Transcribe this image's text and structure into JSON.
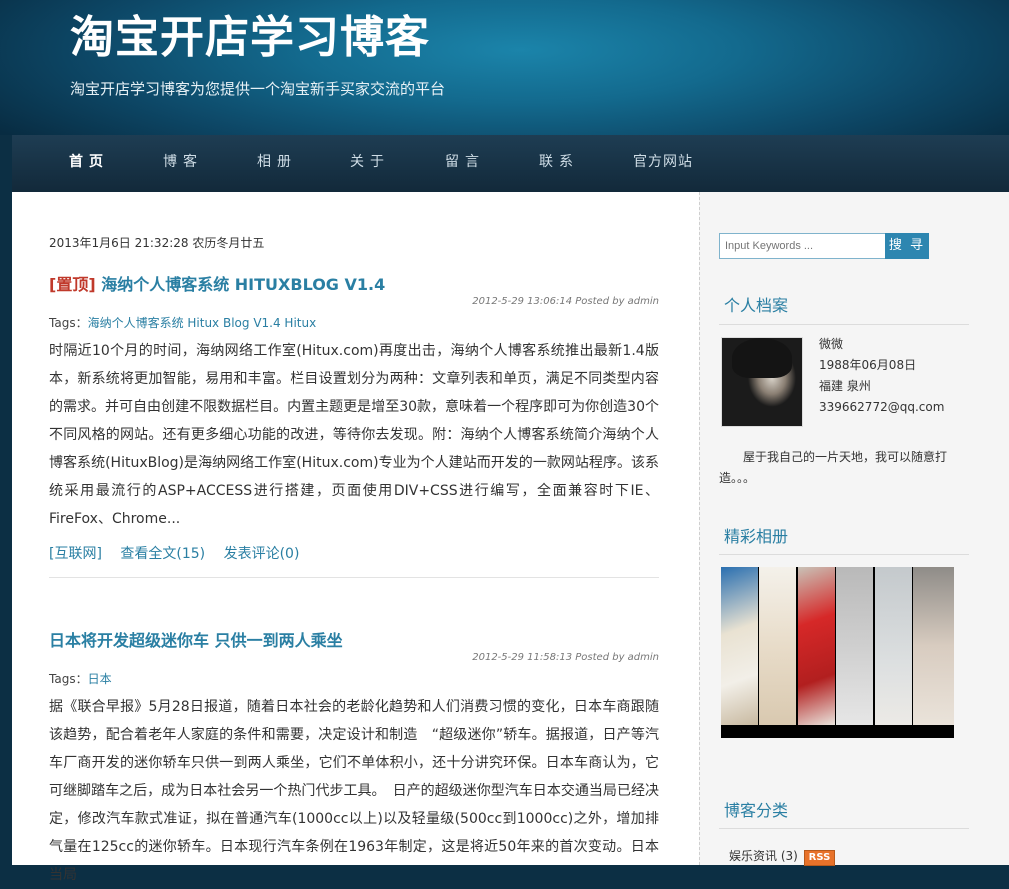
{
  "site": {
    "title": "淘宝开店学习博客",
    "description": "淘宝开店学习博客为您提供一个淘宝新手买家交流的平台"
  },
  "nav": [
    {
      "label": "首页",
      "active": true
    },
    {
      "label": "博客"
    },
    {
      "label": "相册"
    },
    {
      "label": "关于"
    },
    {
      "label": "留言"
    },
    {
      "label": "联系"
    },
    {
      "label": "官方网站"
    }
  ],
  "main": {
    "date_line": "2013年1月6日 21:32:28 农历冬月廿五",
    "posts": [
      {
        "pinned_label": "[置顶]",
        "title": "海纳个人博客系统 HITUXBLOG V1.4",
        "meta": "2012-5-29 13:06:14  Posted by admin",
        "tags_label": "Tags：",
        "tags": "海纳个人博客系统 Hitux Blog V1.4 Hitux",
        "body": "时隔近10个月的时间，海纳网络工作室(Hitux.com)再度出击，海纳个人博客系统推出最新1.4版本，新系统将更加智能，易用和丰富。栏目设置划分为两种：文章列表和单页，满足不同类型内容的需求。并可自由创建不限数据栏目。内置主题更是增至30款，意味着一个程序即可为你创造30个不同风格的网站。还有更多细心功能的改进，等待你去发现。附：海纳个人博客系统简介海纳个人博客系统(HituxBlog)是海纳网络工作室(Hitux.com)专业为个人建站而开发的一款网站程序。该系统采用最流行的ASP+ACCESS进行搭建，页面使用DIV+CSS进行编写，全面兼容时下IE、FireFox、Chrome...",
        "category": "[互联网]",
        "read_more": "查看全文(15)",
        "comment": "发表评论(0)"
      },
      {
        "title": "日本将开发超级迷你车 只供一到两人乘坐",
        "meta": "2012-5-29 11:58:13  Posted by admin",
        "tags_label": "Tags：",
        "tags": "日本",
        "body": "据《联合早报》5月28日报道，随着日本社会的老龄化趋势和人们消费习惯的变化，日本车商跟随该趋势，配合着老年人家庭的条件和需要，决定设计和制造　“超级迷你”轿车。据报道，日产等汽车厂商开发的迷你轿车只供一到两人乘坐，它们不单体积小，还十分讲究环保。日本车商认为，它可继脚踏车之后，成为日本社会另一个热门代步工具。　日产的超级迷你型汽车日本交通当局已经决定，修改汽车款式准证，拟在普通汽车(1000cc以上)以及轻量级(500cc到1000cc)之外，增加排气量在125cc的迷你轿车。日本现行汽车条例在1963年制定，这是将近50年来的首次变动。日本当局"
      }
    ]
  },
  "sidebar": {
    "search": {
      "placeholder": "Input Keywords ...",
      "button": "搜 寻"
    },
    "profile": {
      "heading": "个人档案",
      "name": "微微",
      "birthday": "1988年06月08日",
      "location": "福建 泉州",
      "email": "339662772@qq.com",
      "bio": "屋于我自己的一片天地，我可以随意打造。。。"
    },
    "album": {
      "heading": "精彩相册"
    },
    "categories": {
      "heading": "博客分类",
      "items": [
        {
          "label": "娱乐资讯 (3)",
          "badge": "RSS"
        }
      ]
    }
  }
}
